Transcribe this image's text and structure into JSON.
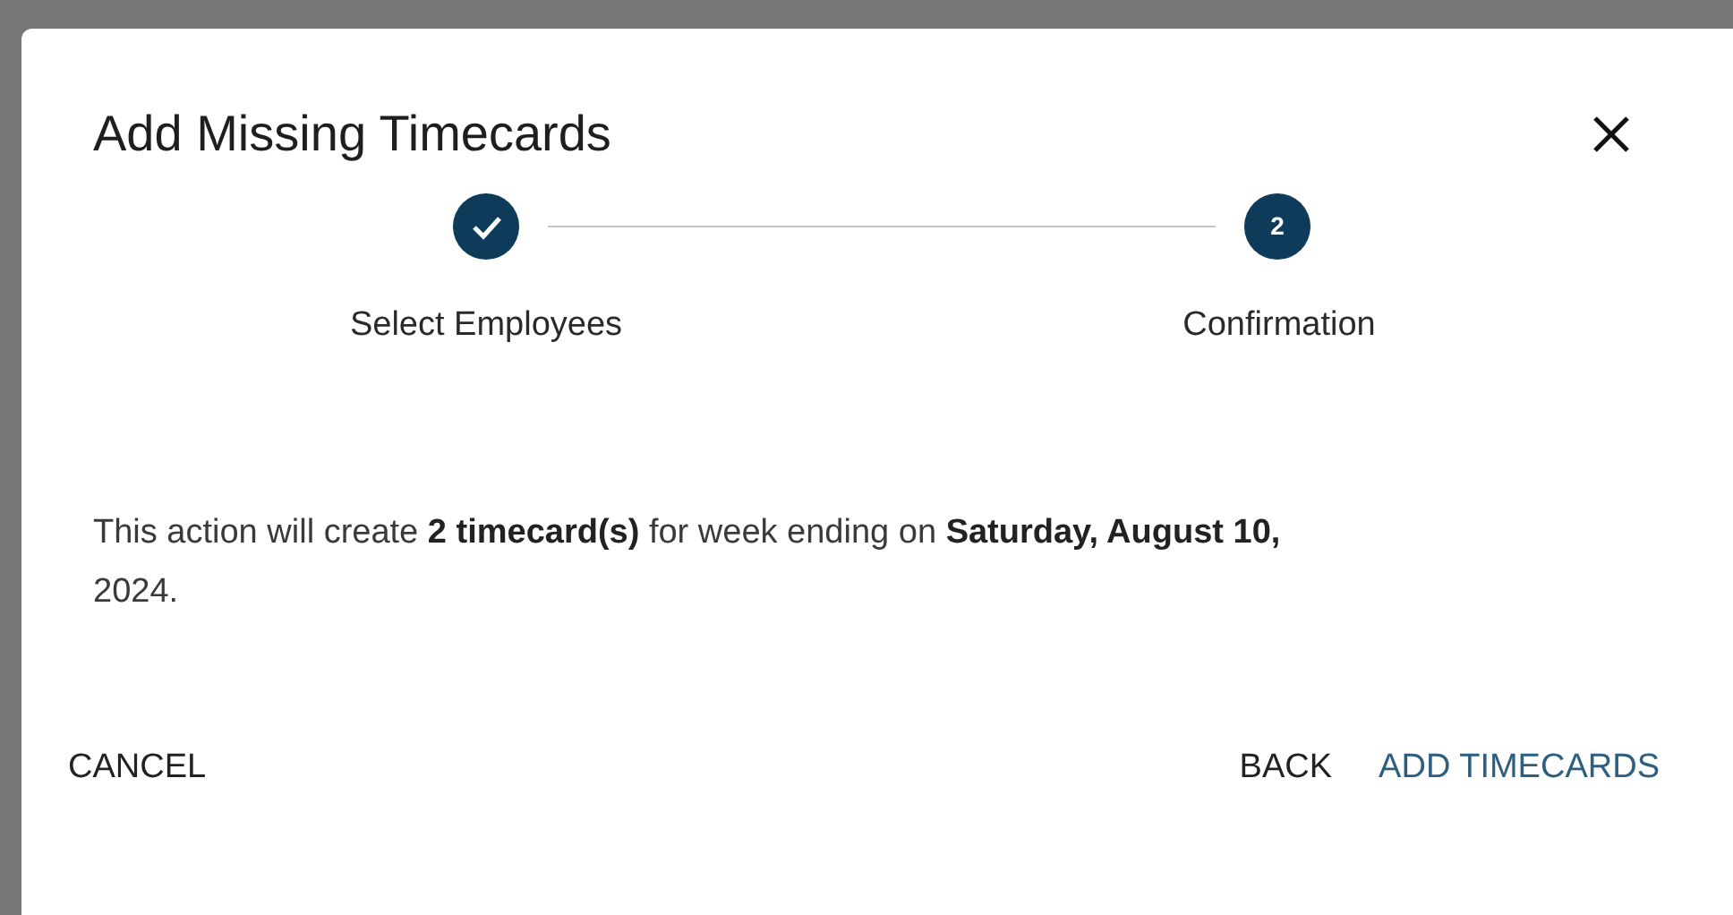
{
  "dialog": {
    "title": "Add Missing Timecards"
  },
  "steps": [
    {
      "label": "Select Employees",
      "completed": true,
      "active": false
    },
    {
      "label": "Confirmation",
      "completed": false,
      "active": true,
      "number": "2"
    }
  ],
  "message": "This action will create **2 timecard(s)** for week ending on **Saturday, August 10,** 2024.",
  "actions": [
    {
      "label": "CANCEL",
      "kind": "secondary"
    },
    {
      "label": "BACK",
      "kind": "secondary"
    },
    {
      "label": "ADD TIMECARDS",
      "kind": "primary"
    }
  ]
}
